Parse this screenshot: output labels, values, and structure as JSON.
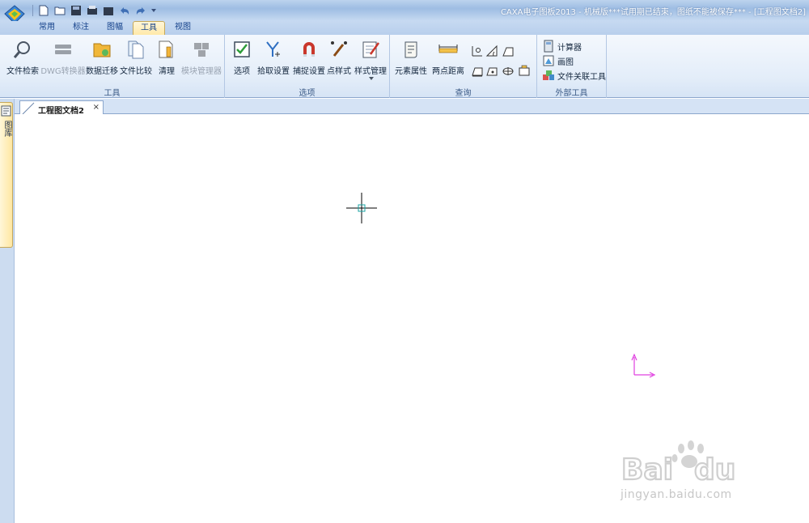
{
  "window": {
    "title": "CAXA电子图板2013 - 机械版***试用期已结束，图纸不能被保存*** - [工程图文档2]"
  },
  "ribbon_tabs": [
    {
      "label": "常用"
    },
    {
      "label": "标注"
    },
    {
      "label": "图幅"
    },
    {
      "label": "工具",
      "active": true
    },
    {
      "label": "视图"
    }
  ],
  "groups": {
    "tools": {
      "label": "工具",
      "buttons": [
        {
          "label": "文件检索",
          "icon": "magnifier-icon"
        },
        {
          "label": "DWG转换器",
          "icon": "dwg-converter-icon",
          "disabled": true
        },
        {
          "label": "数据迁移",
          "icon": "data-migration-icon"
        },
        {
          "label": "文件比较",
          "icon": "file-compare-icon"
        },
        {
          "label": "清理",
          "icon": "cleanup-icon"
        },
        {
          "label": "模块管理器",
          "icon": "module-manager-icon",
          "disabled": true
        }
      ]
    },
    "options": {
      "label": "选项",
      "buttons": [
        {
          "label": "选项",
          "icon": "checkbox-icon"
        },
        {
          "label": "拾取设置",
          "icon": "pick-setting-icon"
        },
        {
          "label": "捕捉设置",
          "icon": "magnet-icon"
        },
        {
          "label": "点样式",
          "icon": "point-style-icon"
        },
        {
          "label": "样式管理",
          "icon": "style-manager-icon"
        }
      ]
    },
    "query": {
      "label": "查询",
      "buttons": [
        {
          "label": "元素属性",
          "icon": "scroll-icon"
        },
        {
          "label": "两点距离",
          "icon": "ruler-icon"
        }
      ]
    },
    "external": {
      "label": "外部工具",
      "items": [
        {
          "label": "计算器",
          "icon": "calculator-icon"
        },
        {
          "label": "画图",
          "icon": "paint-icon"
        },
        {
          "label": "文件关联工具",
          "icon": "file-association-icon"
        }
      ]
    }
  },
  "left_panel": {
    "tab_label": "图库"
  },
  "document_tab": {
    "title": "工程图文档2",
    "close": "×"
  },
  "watermark": {
    "text": "jingyan.baidu.com"
  },
  "colors": {
    "accent": "#15428b",
    "axis": "#e040e0",
    "cursor": "#000000"
  }
}
